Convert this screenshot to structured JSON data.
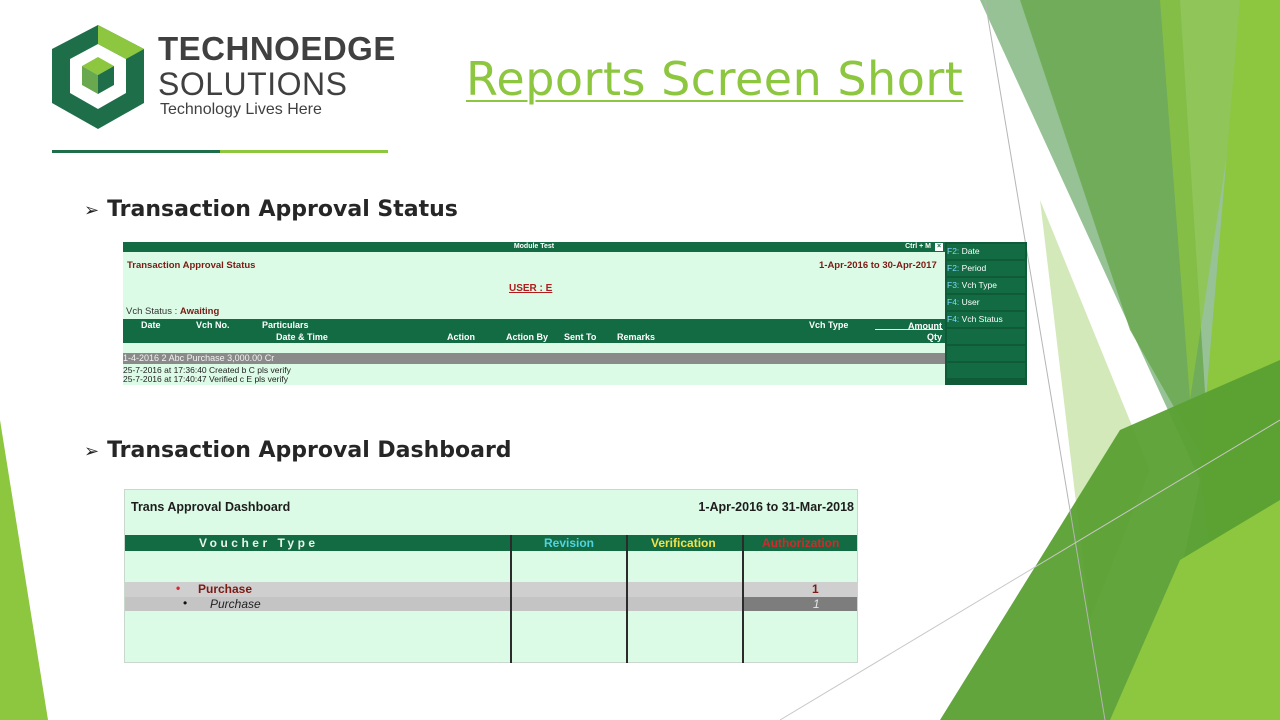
{
  "logo": {
    "line1": "TECHNOEDGE",
    "line2": "SOLUTIONS",
    "tagline": "Technology Lives Here"
  },
  "slide": {
    "title": "Reports Screen Short"
  },
  "bullets": [
    "Transaction Approval Status",
    "Transaction Approval Dashboard"
  ],
  "screen1": {
    "window_title": "Module Test",
    "shortcut": "Ctrl + M",
    "close": "×",
    "report_name": "Transaction Approval Status",
    "period": "1-Apr-2016 to 30-Apr-2017",
    "user": "USER : E",
    "vch_status_label": "Vch Status :",
    "vch_status_value": "Awaiting",
    "headers": {
      "date": "Date",
      "vch_no": "Vch No.",
      "particulars": "Particulars",
      "date_time": "Date & Time",
      "action": "Action",
      "action_by": "Action By",
      "sent_to": "Sent To",
      "remarks": "Remarks",
      "vch_type": "Vch Type",
      "amount": "Amount",
      "qty": "Qty"
    },
    "main_row": {
      "date": "1-4-2016",
      "vch_no": "2",
      "particulars": "Abc",
      "vch_type": "Purchase",
      "amount": "3,000.00 Cr"
    },
    "sub_rows": [
      {
        "date_time": "25-7-2016 at 17:36:40",
        "action": "Created",
        "action_by": "b",
        "sent_to": "C",
        "remarks": "pls verify"
      },
      {
        "date_time": "25-7-2016 at 17:40:47",
        "action": "Verified",
        "action_by": "c",
        "sent_to": "E",
        "remarks": "pls verify"
      }
    ],
    "side_buttons": [
      {
        "key": "F2:",
        "label": "Date"
      },
      {
        "key": "F2:",
        "label": "Period"
      },
      {
        "key": "F3:",
        "label": "Vch Type"
      },
      {
        "key": "F4:",
        "label": "User"
      },
      {
        "key": "F4:",
        "label": "Vch Status"
      }
    ]
  },
  "screen2": {
    "report_name": "Trans Approval Dashboard",
    "period": "1-Apr-2016 to 31-Mar-2018",
    "headers": {
      "voucher_type": "Voucher Type",
      "revision": "Revision",
      "verification": "Verification",
      "authorization": "Authorization"
    },
    "rows": [
      {
        "bullet": "•",
        "name": "Purchase",
        "authorization": "1"
      },
      {
        "bullet": "•",
        "name": "Purchase",
        "authorization": "1"
      }
    ]
  },
  "colors": {
    "brand_green": "#136b43",
    "accent_lime": "#8dc63f",
    "screen_bg": "#dcfbe6",
    "maroon": "#7a1b14"
  }
}
